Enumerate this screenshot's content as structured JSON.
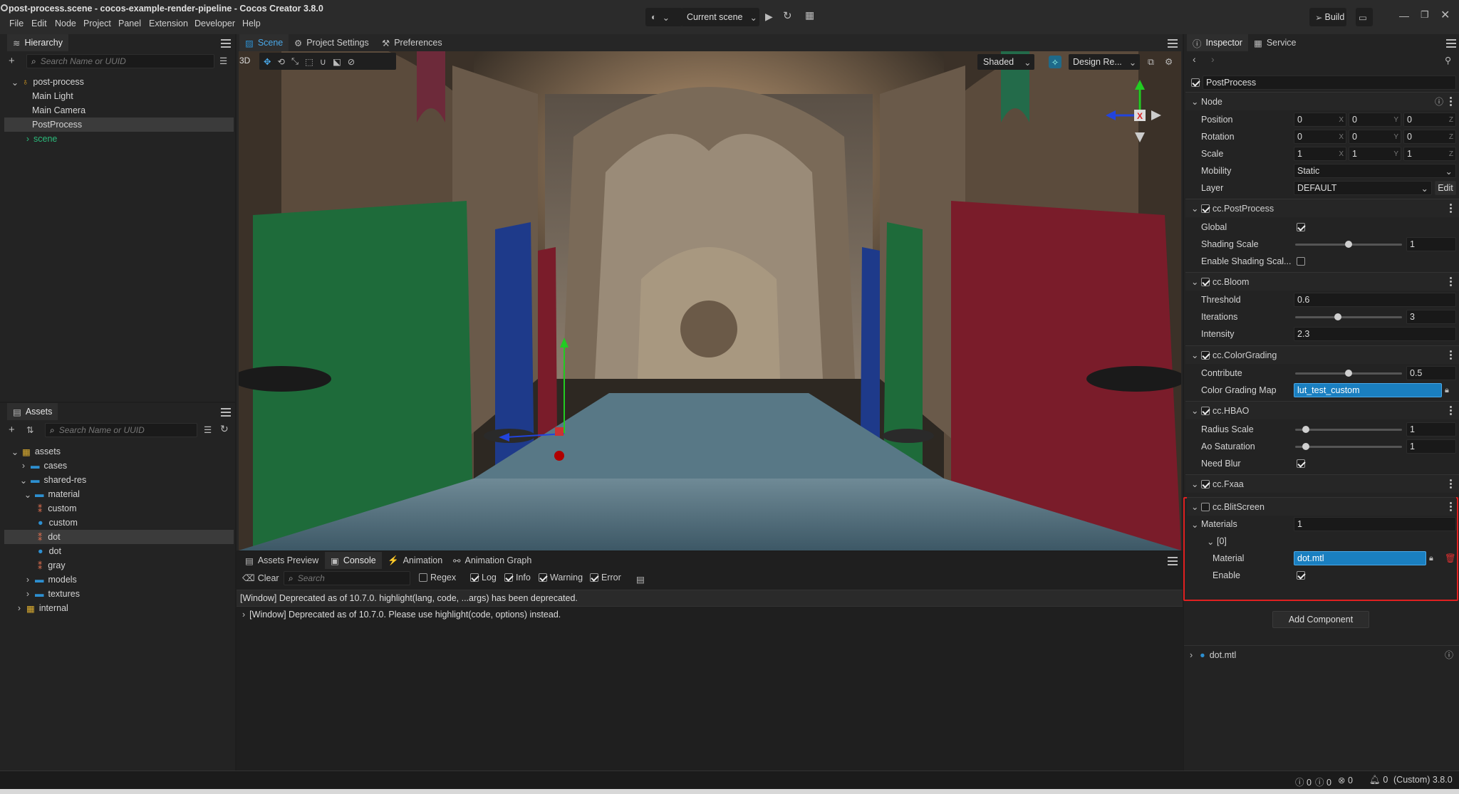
{
  "window": {
    "title": "post-process.scene - cocos-example-render-pipeline - Cocos Creator 3.8.0"
  },
  "menu": [
    "File",
    "Edit",
    "Node",
    "Project",
    "Panel",
    "Extension",
    "Developer",
    "Help"
  ],
  "toolbar": {
    "scene_select": "Current scene",
    "build_label": "Build"
  },
  "hierarchy": {
    "tab": "Hierarchy",
    "search_placeholder": "Search Name or UUID",
    "items": [
      {
        "label": "post-process"
      },
      {
        "label": "Main Light"
      },
      {
        "label": "Main Camera"
      },
      {
        "label": "PostProcess"
      },
      {
        "label": "scene"
      }
    ]
  },
  "scene_tabs": [
    "Scene",
    "Project Settings",
    "Preferences"
  ],
  "scene_toolbar": {
    "mode_3d": "3D",
    "shading": "Shaded",
    "design_res": "Design Re..."
  },
  "assets": {
    "tab": "Assets",
    "search_placeholder": "Search Name or UUID",
    "items": [
      {
        "label": "assets"
      },
      {
        "label": "cases"
      },
      {
        "label": "shared-res"
      },
      {
        "label": "material"
      },
      {
        "label": "custom"
      },
      {
        "label": "custom"
      },
      {
        "label": "dot"
      },
      {
        "label": "dot"
      },
      {
        "label": "gray"
      },
      {
        "label": "models"
      },
      {
        "label": "textures"
      },
      {
        "label": "internal"
      }
    ]
  },
  "bottom_tabs": [
    "Assets Preview",
    "Console",
    "Animation",
    "Animation Graph"
  ],
  "console": {
    "clear": "Clear",
    "search_placeholder": "Search",
    "filters": [
      "Regex",
      "Log",
      "Info",
      "Warning",
      "Error"
    ],
    "messages": [
      "[Window] Deprecated as of 10.7.0. highlight(lang, code, ...args) has been deprecated.",
      "[Window] Deprecated as of 10.7.0. Please use highlight(code, options) instead."
    ]
  },
  "inspector": {
    "tabs": [
      "Inspector",
      "Service"
    ],
    "node_name": "PostProcess",
    "node_section": "Node",
    "position": {
      "label": "Position",
      "x": "0",
      "y": "0",
      "z": "0"
    },
    "rotation": {
      "label": "Rotation",
      "x": "0",
      "y": "0",
      "z": "0"
    },
    "scale": {
      "label": "Scale",
      "x": "1",
      "y": "1",
      "z": "1"
    },
    "mobility": {
      "label": "Mobility",
      "value": "Static"
    },
    "layer": {
      "label": "Layer",
      "value": "DEFAULT",
      "edit": "Edit"
    },
    "postprocess": {
      "title": "cc.PostProcess",
      "global": "Global",
      "shading_scale": "Shading Scale",
      "shading_scale_value": "1",
      "shading_scale_level": 0.5,
      "enable_shading": "Enable Shading Scal..."
    },
    "bloom": {
      "title": "cc.Bloom",
      "threshold": "Threshold",
      "threshold_value": "0.6",
      "iterations": "Iterations",
      "iterations_value": "3",
      "iterations_level": 0.4,
      "intensity": "Intensity",
      "intensity_value": "2.3"
    },
    "colorgrading": {
      "title": "cc.ColorGrading",
      "contribute": "Contribute",
      "contribute_value": "0.5",
      "contribute_level": 0.5,
      "map": "Color Grading Map",
      "map_value": "lut_test_custom"
    },
    "hbao": {
      "title": "cc.HBAO",
      "radius": "Radius Scale",
      "radius_value": "1",
      "radius_level": 0.1,
      "ao": "Ao Saturation",
      "ao_value": "1",
      "ao_level": 0.1,
      "blur": "Need Blur"
    },
    "fxaa": {
      "title": "cc.Fxaa"
    },
    "blit": {
      "title": "cc.BlitScreen",
      "materials": "Materials",
      "materials_count": "1",
      "index": "[0]",
      "material": "Material",
      "material_value": "dot.mtl",
      "enable": "Enable"
    },
    "add_component": "Add Component",
    "asset_preview": "dot.mtl"
  },
  "status": {
    "c1": "0",
    "c2": "0",
    "c3": "0",
    "c4": "0",
    "version": "(Custom) 3.8.0"
  },
  "colors": {
    "accent": "#2d8fd0",
    "highlight_border": "#e02020",
    "field_blue": "#1a7fc0"
  }
}
